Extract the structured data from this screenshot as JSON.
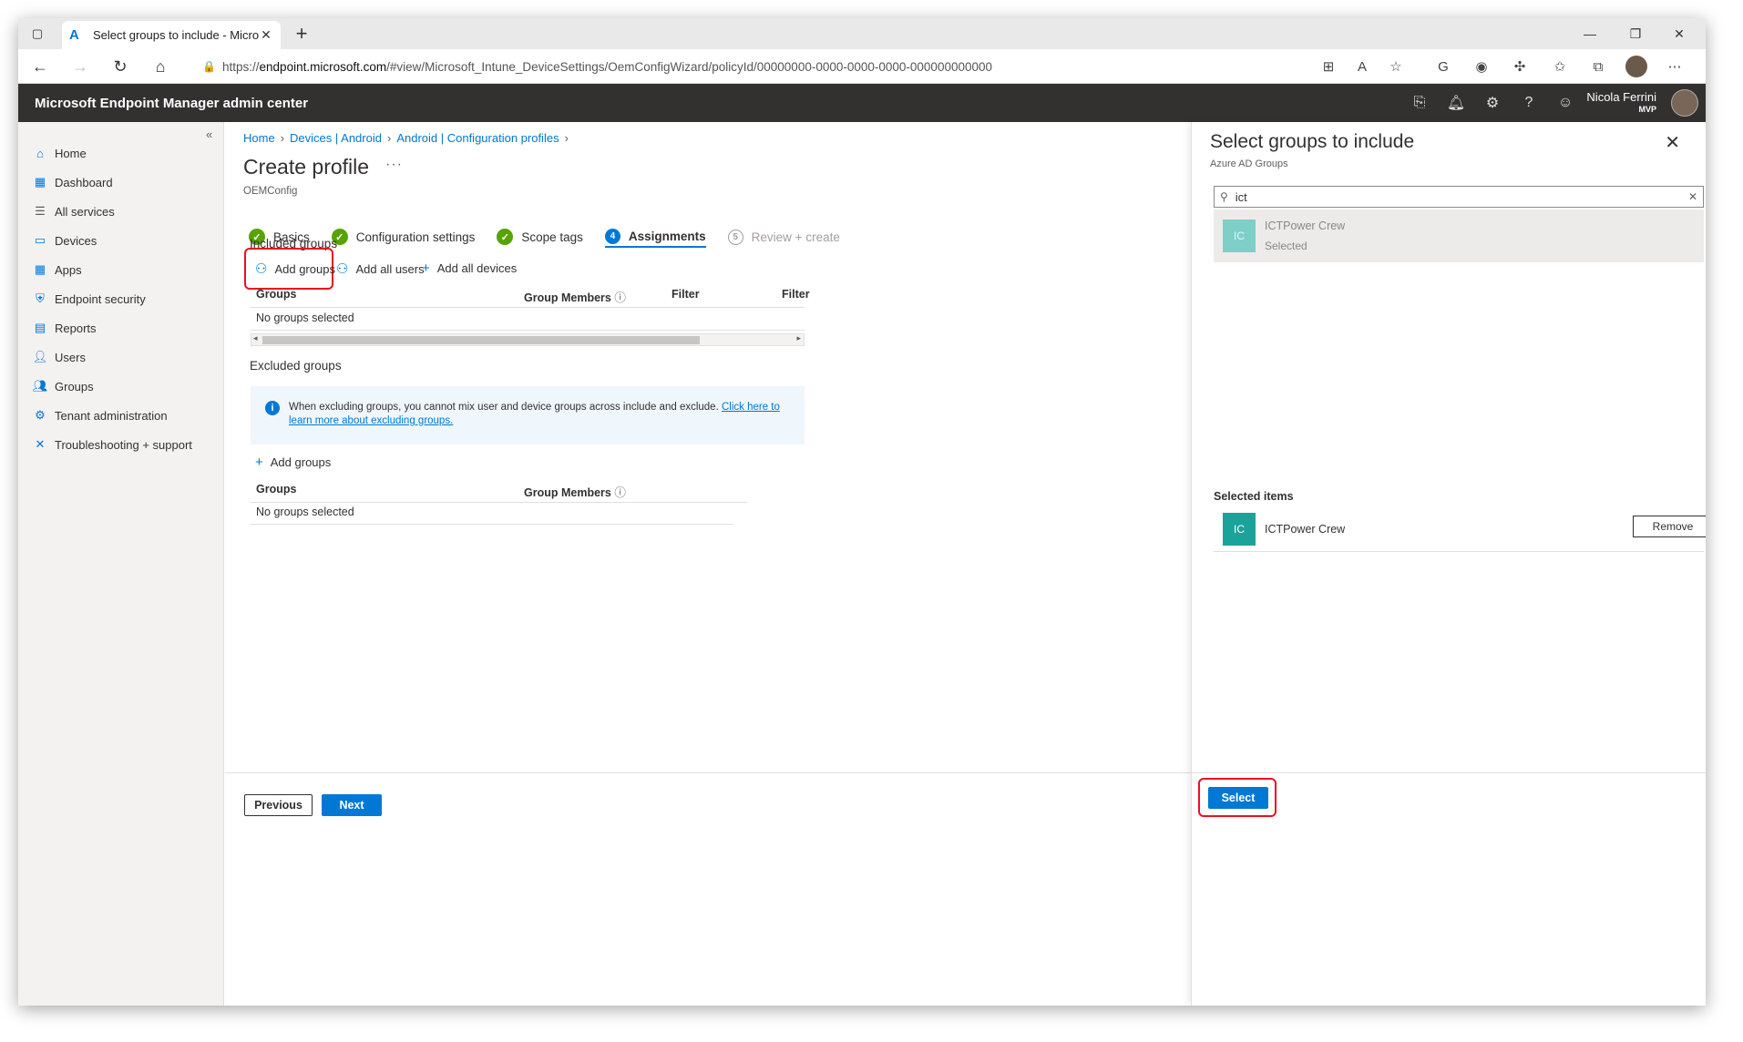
{
  "browser": {
    "tab_title": "Select groups to include - Micro",
    "url_prefix": "https://",
    "url_host": "endpoint.microsoft.com",
    "url_path": "/#view/Microsoft_Intune_DeviceSettings/OemConfigWizard/policyId/00000000-0000-0000-0000-000000000000"
  },
  "portal": {
    "brand": "Microsoft Endpoint Manager admin center",
    "user_name": "Nicola Ferrini",
    "user_badge": "MVP"
  },
  "sidebar": {
    "items": [
      {
        "label": "Home",
        "icon": "home-icon",
        "color": "#0078d4"
      },
      {
        "label": "Dashboard",
        "icon": "dashboard-icon",
        "color": "#0078d4"
      },
      {
        "label": "All services",
        "icon": "list-icon",
        "color": "#605e5c"
      },
      {
        "label": "Devices",
        "icon": "devices-icon",
        "color": "#0078d4"
      },
      {
        "label": "Apps",
        "icon": "apps-icon",
        "color": "#0078d4"
      },
      {
        "label": "Endpoint security",
        "icon": "shield-icon",
        "color": "#0078d4"
      },
      {
        "label": "Reports",
        "icon": "reports-icon",
        "color": "#0078d4"
      },
      {
        "label": "Users",
        "icon": "user-icon",
        "color": "#0078d4"
      },
      {
        "label": "Groups",
        "icon": "groups-icon",
        "color": "#0078d4"
      },
      {
        "label": "Tenant administration",
        "icon": "tenant-icon",
        "color": "#0078d4"
      },
      {
        "label": "Troubleshooting + support",
        "icon": "wrench-icon",
        "color": "#0078d4"
      }
    ]
  },
  "breadcrumb": [
    "Home",
    "Devices | Android",
    "Android | Configuration profiles"
  ],
  "page": {
    "title": "Create profile",
    "subtitle": "OEMConfig"
  },
  "steps": [
    {
      "label": "Basics",
      "state": "done"
    },
    {
      "label": "Configuration settings",
      "state": "done"
    },
    {
      "label": "Scope tags",
      "state": "done"
    },
    {
      "label": "Assignments",
      "state": "active",
      "num": "4"
    },
    {
      "label": "Review + create",
      "state": "disabled",
      "num": "5"
    }
  ],
  "included": {
    "label": "Included groups",
    "add_groups": "Add groups",
    "add_all_users": "Add all users",
    "add_all_devices": "Add all devices",
    "columns": [
      "Groups",
      "Group Members",
      "Filter",
      "Filter"
    ],
    "empty": "No groups selected"
  },
  "excluded": {
    "label": "Excluded groups",
    "info_text": "When excluding groups, you cannot mix user and device groups across include and exclude. ",
    "info_link": "Click here to learn more about excluding groups.",
    "add_groups": "Add groups",
    "columns": [
      "Groups",
      "Group Members"
    ],
    "empty": "No groups selected"
  },
  "footer": {
    "previous": "Previous",
    "next": "Next"
  },
  "panel": {
    "title": "Select groups to include",
    "subtitle": "Azure AD Groups",
    "search_value": "ict",
    "result": {
      "initials": "IC",
      "name": "ICTPower Crew",
      "status": "Selected"
    },
    "selected_header": "Selected items",
    "selected": [
      {
        "initials": "IC",
        "name": "ICTPower Crew",
        "action": "Remove"
      }
    ],
    "select_button": "Select"
  },
  "colors": {
    "accent": "#0078d4",
    "success": "#57a300",
    "highlight": "#e81123",
    "header_bg": "#323130",
    "tile": "#1aa39a"
  }
}
